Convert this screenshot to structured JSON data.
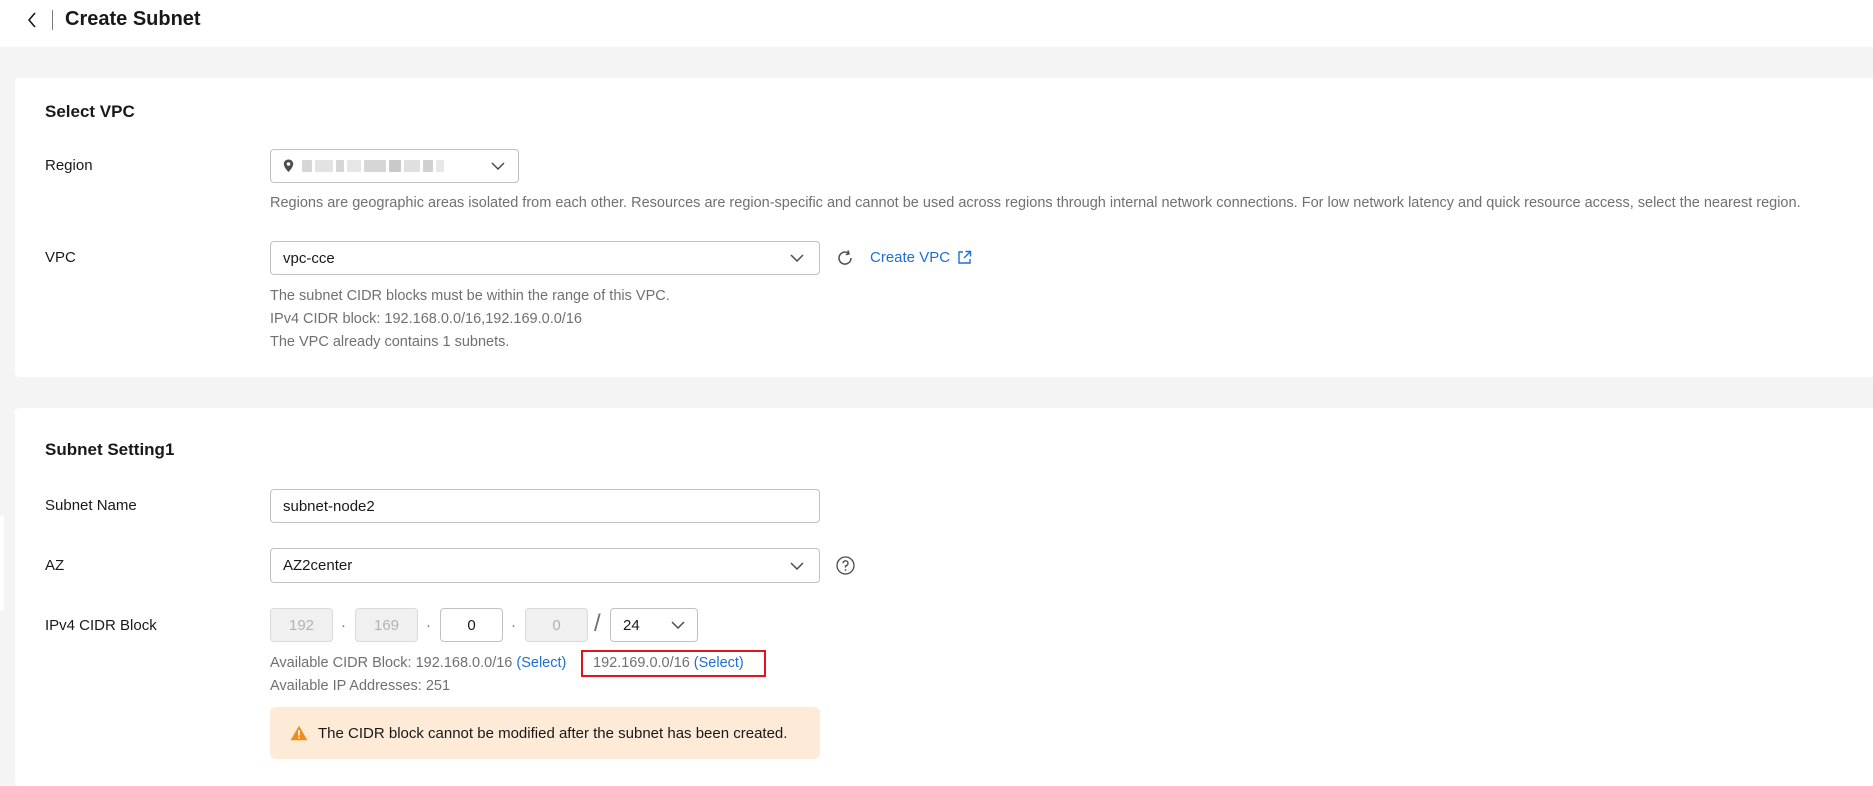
{
  "header": {
    "title": "Create Subnet"
  },
  "select_vpc": {
    "section_title": "Select VPC",
    "region_label": "Region",
    "region_hint": "Regions are geographic areas isolated from each other. Resources are region-specific and cannot be used across regions through internal network connections. For low network latency and quick resource access, select the nearest region.",
    "vpc_label": "VPC",
    "vpc_value": "vpc-cce",
    "create_vpc_label": "Create VPC",
    "vpc_hint_1": "The subnet CIDR blocks must be within the range of this VPC.",
    "vpc_hint_2": "IPv4 CIDR block: 192.168.0.0/16,192.169.0.0/16",
    "vpc_hint_3": "The VPC already contains 1 subnets."
  },
  "subnet_setting": {
    "section_title": "Subnet Setting1",
    "name_label": "Subnet Name",
    "name_value": "subnet-node2",
    "az_label": "AZ",
    "az_value": "AZ2center",
    "cidr_label": "IPv4 CIDR Block",
    "octets": [
      "192",
      "169",
      "0",
      "0"
    ],
    "dot": "·",
    "slash": "/",
    "mask": "24",
    "available_prefix": "Available CIDR Block: 192.168.0.0/16",
    "select_label_1": "(Select)",
    "available_cidr_2": "192.169.0.0/16",
    "select_label_2": "(Select)",
    "available_ips": "Available IP Addresses: 251",
    "warning": "The CIDR block cannot be modified after the subnet has been created."
  },
  "colors": {
    "link": "#1f6ed4",
    "highlight": "#e0141a",
    "warning_bg": "#fdebd8",
    "warning_icon": "#f08c1e"
  },
  "icons": [
    "back-arrow-icon",
    "location-pin-icon",
    "chevron-down-icon",
    "refresh-icon",
    "external-link-icon",
    "help-icon",
    "warning-icon"
  ]
}
